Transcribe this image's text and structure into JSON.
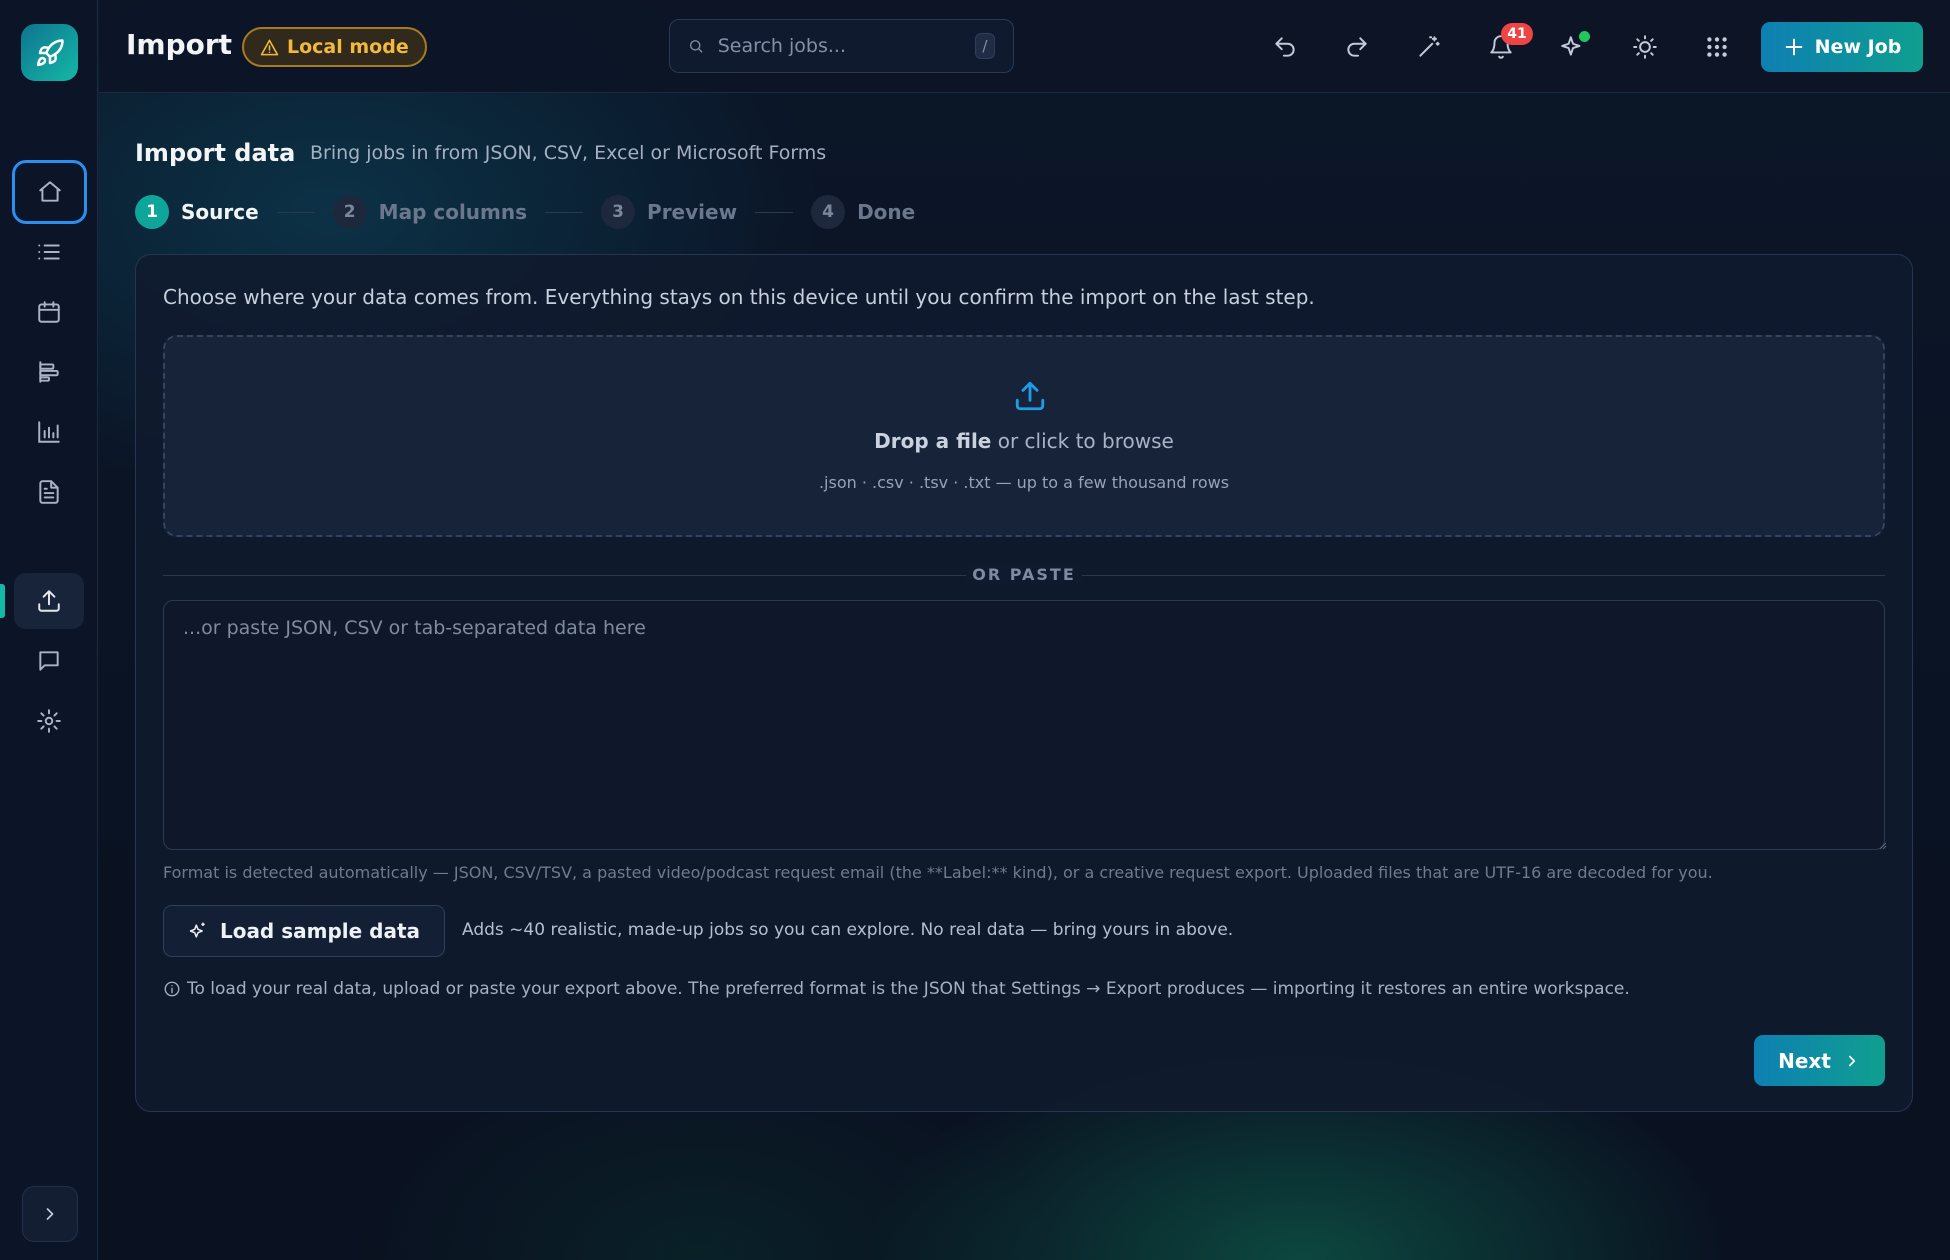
{
  "header": {
    "title": "Import",
    "mode_badge": "Local mode",
    "search_placeholder": "Search jobs...",
    "search_shortcut": "/",
    "notifications_count": "41",
    "new_job_label": "New Job"
  },
  "page": {
    "title": "Import data",
    "subtitle": "Bring jobs in from JSON, CSV, Excel or Microsoft Forms"
  },
  "steps": [
    {
      "num": "1",
      "label": "Source"
    },
    {
      "num": "2",
      "label": "Map columns"
    },
    {
      "num": "3",
      "label": "Preview"
    },
    {
      "num": "4",
      "label": "Done"
    }
  ],
  "source": {
    "intro": "Choose where your data comes from. Everything stays on this device until you confirm the import on the last step.",
    "drop_strong": "Drop a file",
    "drop_rest": " or click to browse",
    "drop_hint": ".json · .csv · .tsv · .txt — up to a few thousand rows",
    "divider": "OR PASTE",
    "paste_placeholder": "...or paste JSON, CSV or tab-separated data here",
    "format_note": "Format is detected automatically — JSON, CSV/TSV, a pasted video/podcast request email (the **Label:** kind), or a creative request export. Uploaded files that are UTF-16 are decoded for you.",
    "sample_button": "Load sample data",
    "sample_note": "Adds ~40 realistic, made-up jobs so you can explore. No real data — bring yours in above.",
    "info_line": "To load your real data, upload or paste your export above. The preferred format is the JSON that Settings → Export produces — importing it restores an entire workspace.",
    "next_button": "Next"
  },
  "colors": {
    "accent": "#0ea59a",
    "primary_gradient_start": "#0e7fb3",
    "warning": "#f2b93b",
    "danger": "#ef4444"
  }
}
